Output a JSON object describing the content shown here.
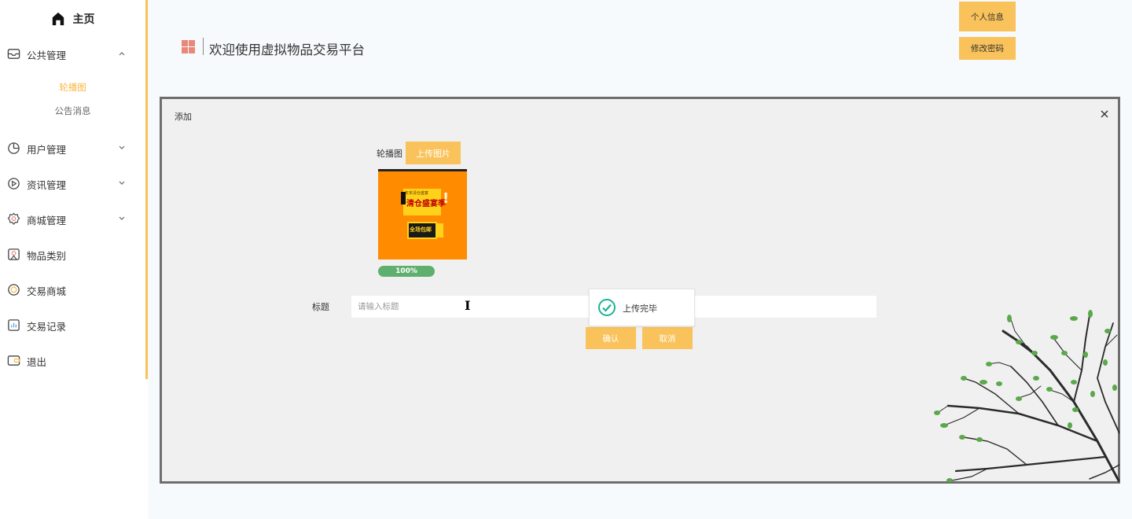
{
  "sidebar": {
    "home_label": "主页",
    "items": [
      {
        "label": "公共管理",
        "icon": "inbox-icon",
        "expanded": true
      },
      {
        "label": "用户管理",
        "icon": "pie-chart-icon"
      },
      {
        "label": "资讯管理",
        "icon": "play-circle-icon"
      },
      {
        "label": "商城管理",
        "icon": "settings-icon"
      },
      {
        "label": "物品类别",
        "icon": "category-icon"
      },
      {
        "label": "交易商城",
        "icon": "coin-icon"
      },
      {
        "label": "交易记录",
        "icon": "chart-icon"
      },
      {
        "label": "退出",
        "icon": "wallet-icon"
      }
    ],
    "submenu": [
      {
        "label": "轮播图",
        "active": true
      },
      {
        "label": "公告消息",
        "active": false
      }
    ],
    "accent_color": "#f9b73e"
  },
  "header": {
    "title": "欢迎使用虚拟物品交易平台",
    "profile_label": "个人信息",
    "change_password_label": "修改密码"
  },
  "modal": {
    "title": "添加",
    "carousel_label": "轮播图",
    "upload_button": "上传图片",
    "image": {
      "top_text": "年末清仓盛宴",
      "main_text": "清仓盛宴季",
      "badge_text": "全场包邮",
      "left_tag": "劲爆",
      "exclaim": "!",
      "badge_side": "正品"
    },
    "progress": {
      "percent": 100,
      "label": "100%"
    },
    "title_label": "标题",
    "title_placeholder": "请输入标题",
    "title_value": "",
    "confirm_button": "确认",
    "cancel_button": "取消",
    "toast_text": "上传完毕"
  },
  "colors": {
    "button": "#f9c25a",
    "progress": "#5fb06f",
    "success": "#1bb394"
  }
}
